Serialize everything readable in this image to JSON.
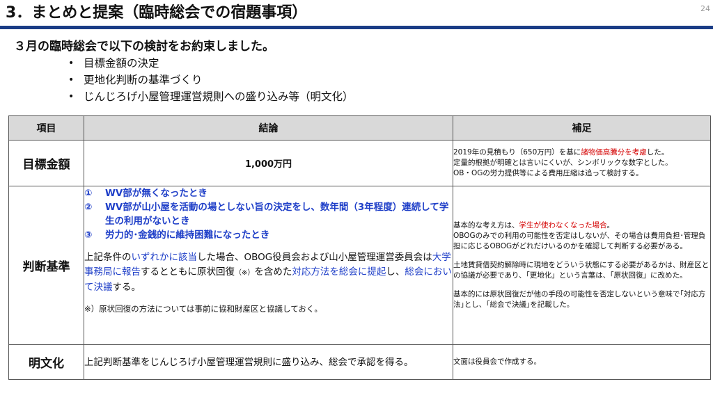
{
  "slide": {
    "title": "3．まとめと提案（臨時総会での宿題事項）",
    "page_number": "24"
  },
  "intro": {
    "heading": "３月の臨時総会で以下の検討をお約束しました。",
    "bullets": [
      "目標金額の決定",
      "更地化判断の基準づくり",
      "じんじろげ小屋管理運営規則への盛り込み等（明文化）"
    ]
  },
  "table": {
    "headers": [
      "項目",
      "結論",
      "補足"
    ],
    "target": {
      "label": "目標金額",
      "conclusion": "1,000万円",
      "note_1_pre": "2019年の見積もり（650万円）を基に",
      "note_1_red": "諸物価高騰分を考慮",
      "note_1_post": "した。",
      "note_2": "定量的根拠が明確とは言いにくいが、シンボリックな数字とした。",
      "note_3": "OB・OGの労力提供等による費用圧縮は追って検討する。"
    },
    "criteria": {
      "label": "判断基準",
      "conditions": [
        {
          "num": "①",
          "text": "WV部が無くなったとき"
        },
        {
          "num": "②",
          "text": "WV部が山小屋を活動の場としない旨の決定をし、数年間（3年程度）連続して学生の利用がないとき"
        },
        {
          "num": "③",
          "text": "労力的･金銭的に維持困難になったとき"
        }
      ],
      "body_1": "上記条件の",
      "body_2": "いずれかに該当",
      "body_3": "した場合、OBOG役員会および山小屋管理運営委員会は",
      "body_4": "大学事務局に報告",
      "body_5": "するとともに原状回復",
      "body_6": "（※）",
      "body_7": "を含めた",
      "body_8": "対応方法を総会に提起",
      "body_9": "し、",
      "body_10": "総会において決議",
      "body_11": "する。",
      "footnote": "※）原状回復の方法については事前に協和財産区と協議しておく。",
      "note_1_pre": "基本的な考え方は、",
      "note_1_red": "学生が使わなくなった場合",
      "note_1_post": "。",
      "note_2": "OBOGのみでの利用の可能性を否定はしないが、その場合は費用負担･管理負担に応じるOBOGがどれだけいるのかを確認して判断する必要がある。",
      "note_3": "土地賃貸借契約解除時に現地をどういう状態にする必要があるかは、財産区との協議が必要であり、「更地化」という言葉は、「原状回復」に改めた。",
      "note_4": "基本的には原状回復だが他の手段の可能性を否定しないという意味で｢対応方法｣とし、｢総会で決議｣を記載した。"
    },
    "documentation": {
      "label": "明文化",
      "conclusion": "上記判断基準をじんじろげ小屋管理運営規則に盛り込み、総会で承認を得る。",
      "note": "文面は役員会で作成する。"
    }
  },
  "colors": {
    "title_rule": "#1a3c86",
    "emphasis_blue": "#1f3fc8",
    "emphasis_red": "#d40000",
    "header_fill": "#d9d9d9"
  }
}
